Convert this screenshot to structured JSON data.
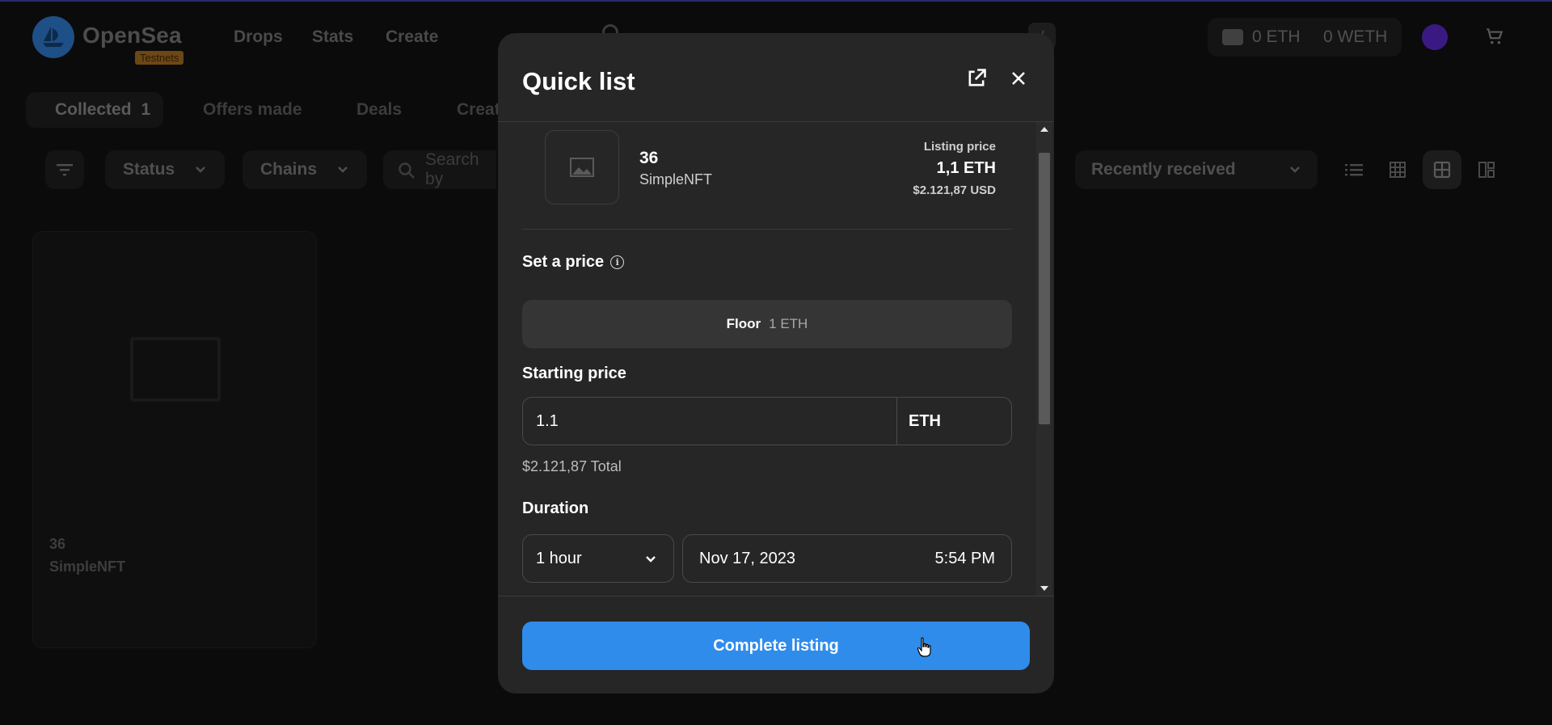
{
  "header": {
    "brand": "OpenSea",
    "badge": "Testnets",
    "nav": [
      "Drops",
      "Stats",
      "Create"
    ],
    "search_shortcut": "/",
    "wallet_eth": "0 ETH",
    "wallet_weth": "0 WETH"
  },
  "tabs": {
    "collected_label": "Collected",
    "collected_count": "1",
    "offers_made": "Offers made",
    "deals": "Deals",
    "created": "Creat"
  },
  "filters": {
    "status": "Status",
    "chains": "Chains",
    "search_placeholder": "Search by",
    "sort": "Recently received"
  },
  "card": {
    "title": "36",
    "collection": "SimpleNFT"
  },
  "modal": {
    "title": "Quick list",
    "item_name": "36",
    "item_collection": "SimpleNFT",
    "listing_price_label": "Listing price",
    "listing_price_eth": "1,1 ETH",
    "listing_price_usd": "$2.121,87 USD",
    "set_price_label": "Set a price",
    "floor_label": "Floor",
    "floor_value": "1 ETH",
    "starting_price_label": "Starting price",
    "starting_price_value": "1.1",
    "currency": "ETH",
    "total": "$2.121,87 Total",
    "duration_label": "Duration",
    "duration_value": "1 hour",
    "end_date": "Nov 17, 2023",
    "end_time": "5:54 PM",
    "complete_button": "Complete listing"
  },
  "colors": {
    "accent": "#2f8ceb",
    "modal_bg": "#262626",
    "page_bg": "#0b0b0b"
  }
}
